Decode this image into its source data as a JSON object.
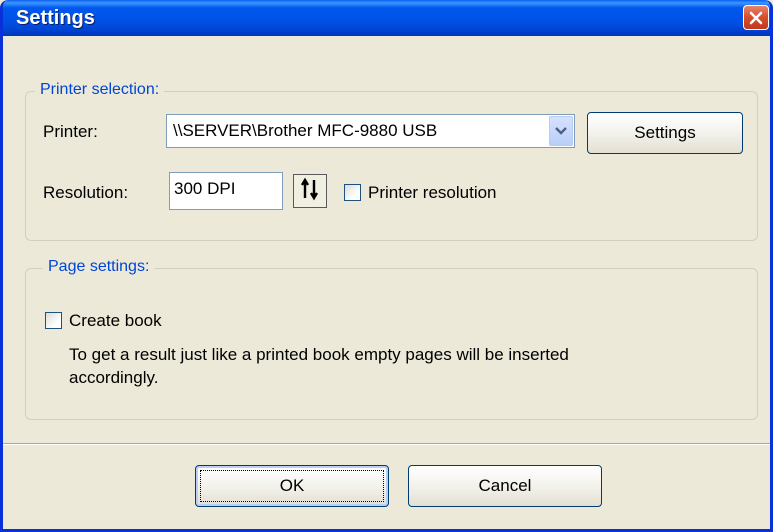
{
  "window": {
    "title": "Settings"
  },
  "printer_group": {
    "legend": "Printer selection:",
    "printer_label": "Printer:",
    "printer_value": "\\\\SERVER\\Brother MFC-9880 USB",
    "settings_button": "Settings",
    "resolution_label": "Resolution:",
    "resolution_value": "300 DPI",
    "printer_resolution_label": "Printer resolution",
    "printer_resolution_checked": false
  },
  "page_group": {
    "legend": "Page settings:",
    "create_book_label": "Create book",
    "create_book_checked": false,
    "description_line1": "To get a result just like a printed book empty pages will be inserted",
    "description_line2": "accordingly."
  },
  "footer": {
    "ok_label": "OK",
    "cancel_label": "Cancel"
  },
  "icons": {
    "close": "close-icon",
    "dropdown": "chevron-down-icon",
    "spin": "spin-arrows-icon"
  },
  "colors": {
    "titlebar": "#0054E3",
    "window_bg": "#ECE9D8",
    "legend": "#0046D5",
    "close": "#D9502E"
  }
}
